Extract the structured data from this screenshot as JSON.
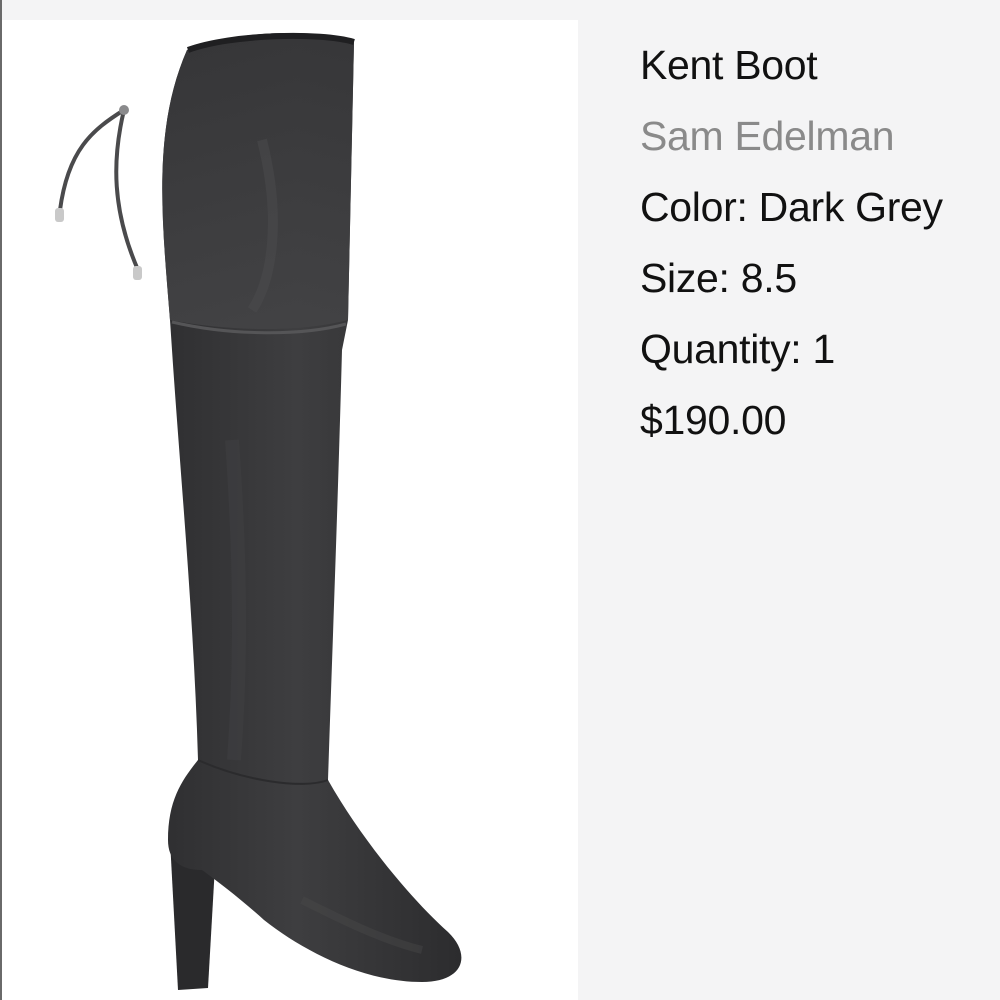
{
  "product": {
    "name": "Kent Boot",
    "brand": "Sam Edelman",
    "color_label": "Color: Dark Grey",
    "size_label": "Size: 8.5",
    "quantity_label": "Quantity: 1",
    "price": "$190.00"
  },
  "image": {
    "subject": "over-the-knee suede heeled boot",
    "icon": "boot-photo"
  },
  "colors": {
    "background": "#f4f4f5",
    "photo_background": "#ffffff",
    "boot": "#3b3b3d",
    "primary_text": "#111111",
    "secondary_text": "#8a8a8a"
  }
}
